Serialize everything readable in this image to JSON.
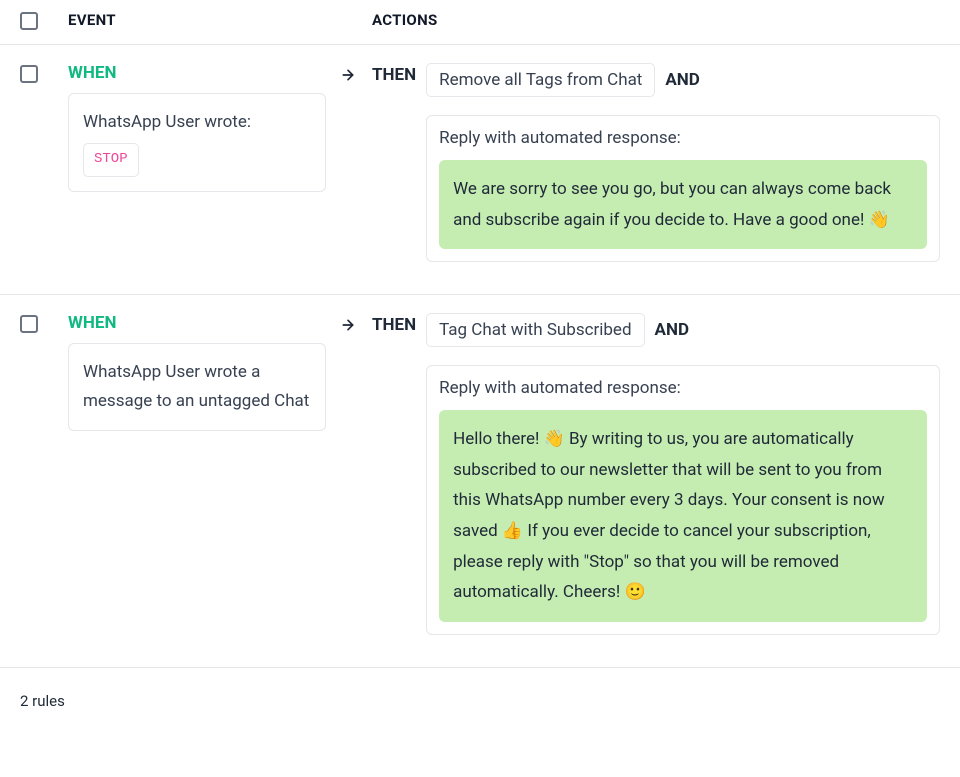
{
  "headers": {
    "event": "EVENT",
    "actions": "ACTIONS"
  },
  "labels": {
    "when": "WHEN",
    "then": "THEN",
    "and": "AND",
    "reply_title": "Reply with automated response:"
  },
  "rules": [
    {
      "event_text": "WhatsApp User wrote:",
      "event_keyword": "STOP",
      "action_pill": "Remove all Tags from Chat",
      "response": "We are sorry to see you go, but you can always come back and subscribe again if you decide to. Have a good one! 👋"
    },
    {
      "event_text": "WhatsApp User wrote a message to an untagged Chat",
      "event_keyword": null,
      "action_pill": "Tag Chat with Subscribed",
      "response": "Hello there! 👋 By writing to us, you are automatically subscribed to our newsletter that will be sent to you from this WhatsApp number every 3 days. Your consent is now saved 👍 If you ever decide to cancel your subscription, please reply with \"Stop\" so that you will be removed automatically. Cheers! 🙂"
    }
  ],
  "footer": {
    "count_text": "2 rules"
  }
}
